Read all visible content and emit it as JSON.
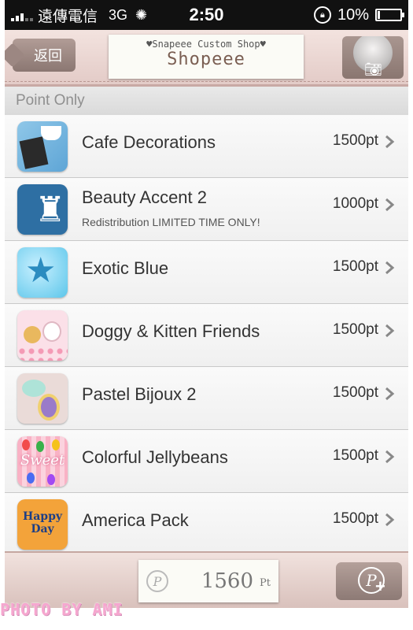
{
  "status_bar": {
    "carrier": "遠傳電信",
    "network": "3G",
    "time": "2:50",
    "battery": "10%",
    "battery_level": 0.1,
    "icons": [
      "signal-icon",
      "loading-spinner-icon",
      "rotation-lock-icon",
      "battery-charging-icon"
    ]
  },
  "nav": {
    "back_label": "返回",
    "logo_line1": "♥Snapeee Custom Shop♥",
    "logo_line2": "Shopeee",
    "camera_icon": "camera-icon"
  },
  "section": {
    "title": "Point Only"
  },
  "items": [
    {
      "name": "Cafe Decorations",
      "subtitle": "",
      "price": "1500pt"
    },
    {
      "name": "Beauty Accent 2",
      "subtitle": "Redistribution LIMITED TIME ONLY!",
      "price": "1000pt"
    },
    {
      "name": "Exotic Blue",
      "subtitle": "",
      "price": "1500pt"
    },
    {
      "name": "Doggy & Kitten Friends",
      "subtitle": "",
      "price": "1500pt"
    },
    {
      "name": "Pastel Bijoux 2",
      "subtitle": "",
      "price": "1500pt"
    },
    {
      "name": "Colorful Jellybeans",
      "subtitle": "",
      "price": "1500pt"
    },
    {
      "name": "America Pack",
      "subtitle": "",
      "price": "1500pt"
    }
  ],
  "thumb_text": {
    "jelly": "Sweet",
    "america": "Happy Day"
  },
  "bottom": {
    "points_icon": "P",
    "points_value": "1560",
    "points_unit": "Pt",
    "buy_points_icon": "P"
  },
  "watermark": "PHOTO BY AMI",
  "colors": {
    "nav_bg": "#e3cbc7",
    "button_bg": "#8b7772",
    "section_text": "#8f8f8f",
    "watermark": "#f6a6cf"
  }
}
